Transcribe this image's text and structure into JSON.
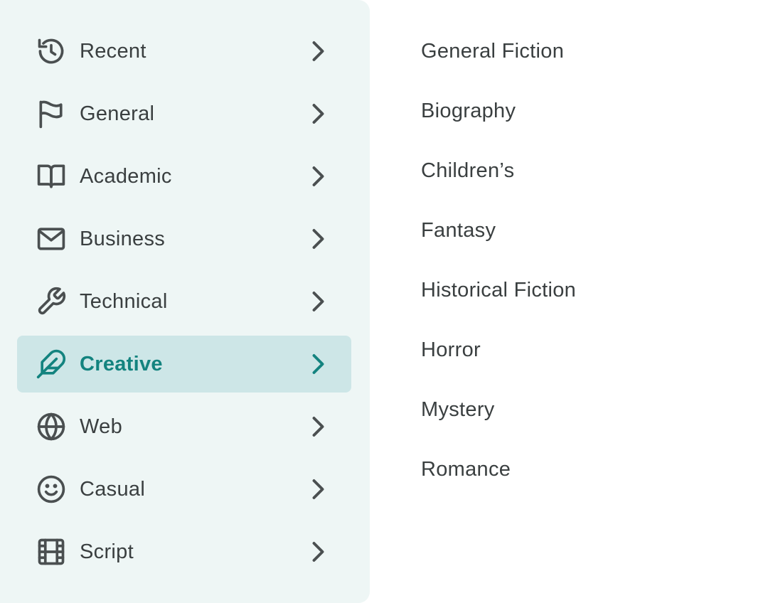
{
  "menu": {
    "items": [
      {
        "label": "Recent",
        "icon": "history-icon",
        "selected": false
      },
      {
        "label": "General",
        "icon": "flag-icon",
        "selected": false
      },
      {
        "label": "Academic",
        "icon": "book-icon",
        "selected": false
      },
      {
        "label": "Business",
        "icon": "envelope-icon",
        "selected": false
      },
      {
        "label": "Technical",
        "icon": "wrench-icon",
        "selected": false
      },
      {
        "label": "Creative",
        "icon": "feather-icon",
        "selected": true
      },
      {
        "label": "Web",
        "icon": "globe-icon",
        "selected": false
      },
      {
        "label": "Casual",
        "icon": "smiley-icon",
        "selected": false
      },
      {
        "label": "Script",
        "icon": "film-icon",
        "selected": false
      }
    ]
  },
  "submenu": {
    "items": [
      "General Fiction",
      "Biography",
      "Children’s",
      "Fantasy",
      "Historical Fiction",
      "Horror",
      "Mystery",
      "Romance"
    ]
  },
  "colors": {
    "sidebar_bg": "#eef6f5",
    "selected_bg": "#cde6e7",
    "accent": "#13837f",
    "text": "#3a3f40",
    "icon": "#4a4f50"
  }
}
